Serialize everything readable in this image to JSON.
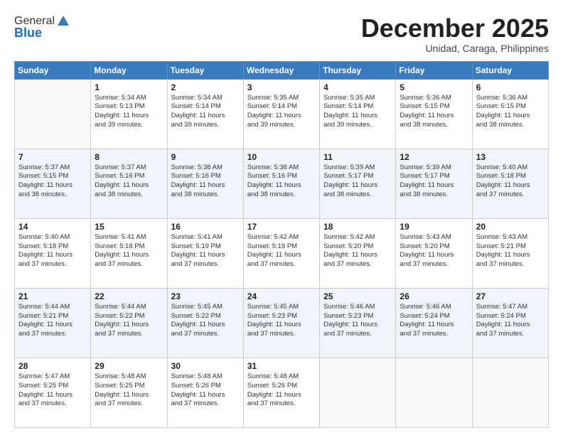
{
  "header": {
    "logo_general": "General",
    "logo_blue": "Blue",
    "month_title": "December 2025",
    "subtitle": "Unidad, Caraga, Philippines"
  },
  "weekdays": [
    "Sunday",
    "Monday",
    "Tuesday",
    "Wednesday",
    "Thursday",
    "Friday",
    "Saturday"
  ],
  "rows": [
    [
      {
        "day": "",
        "text": ""
      },
      {
        "day": "1",
        "text": "Sunrise: 5:34 AM\nSunset: 5:13 PM\nDaylight: 11 hours\nand 39 minutes."
      },
      {
        "day": "2",
        "text": "Sunrise: 5:34 AM\nSunset: 5:14 PM\nDaylight: 11 hours\nand 39 minutes."
      },
      {
        "day": "3",
        "text": "Sunrise: 5:35 AM\nSunset: 5:14 PM\nDaylight: 11 hours\nand 39 minutes."
      },
      {
        "day": "4",
        "text": "Sunrise: 5:35 AM\nSunset: 5:14 PM\nDaylight: 11 hours\nand 39 minutes."
      },
      {
        "day": "5",
        "text": "Sunrise: 5:36 AM\nSunset: 5:15 PM\nDaylight: 11 hours\nand 38 minutes."
      },
      {
        "day": "6",
        "text": "Sunrise: 5:36 AM\nSunset: 5:15 PM\nDaylight: 11 hours\nand 38 minutes."
      }
    ],
    [
      {
        "day": "7",
        "text": "Sunrise: 5:37 AM\nSunset: 5:15 PM\nDaylight: 11 hours\nand 38 minutes."
      },
      {
        "day": "8",
        "text": "Sunrise: 5:37 AM\nSunset: 5:16 PM\nDaylight: 11 hours\nand 38 minutes."
      },
      {
        "day": "9",
        "text": "Sunrise: 5:38 AM\nSunset: 5:16 PM\nDaylight: 11 hours\nand 38 minutes."
      },
      {
        "day": "10",
        "text": "Sunrise: 5:38 AM\nSunset: 5:16 PM\nDaylight: 11 hours\nand 38 minutes."
      },
      {
        "day": "11",
        "text": "Sunrise: 5:39 AM\nSunset: 5:17 PM\nDaylight: 11 hours\nand 38 minutes."
      },
      {
        "day": "12",
        "text": "Sunrise: 5:39 AM\nSunset: 5:17 PM\nDaylight: 11 hours\nand 38 minutes."
      },
      {
        "day": "13",
        "text": "Sunrise: 5:40 AM\nSunset: 5:18 PM\nDaylight: 11 hours\nand 37 minutes."
      }
    ],
    [
      {
        "day": "14",
        "text": "Sunrise: 5:40 AM\nSunset: 5:18 PM\nDaylight: 11 hours\nand 37 minutes."
      },
      {
        "day": "15",
        "text": "Sunrise: 5:41 AM\nSunset: 5:18 PM\nDaylight: 11 hours\nand 37 minutes."
      },
      {
        "day": "16",
        "text": "Sunrise: 5:41 AM\nSunset: 5:19 PM\nDaylight: 11 hours\nand 37 minutes."
      },
      {
        "day": "17",
        "text": "Sunrise: 5:42 AM\nSunset: 5:19 PM\nDaylight: 11 hours\nand 37 minutes."
      },
      {
        "day": "18",
        "text": "Sunrise: 5:42 AM\nSunset: 5:20 PM\nDaylight: 11 hours\nand 37 minutes."
      },
      {
        "day": "19",
        "text": "Sunrise: 5:43 AM\nSunset: 5:20 PM\nDaylight: 11 hours\nand 37 minutes."
      },
      {
        "day": "20",
        "text": "Sunrise: 5:43 AM\nSunset: 5:21 PM\nDaylight: 11 hours\nand 37 minutes."
      }
    ],
    [
      {
        "day": "21",
        "text": "Sunrise: 5:44 AM\nSunset: 5:21 PM\nDaylight: 11 hours\nand 37 minutes."
      },
      {
        "day": "22",
        "text": "Sunrise: 5:44 AM\nSunset: 5:22 PM\nDaylight: 11 hours\nand 37 minutes."
      },
      {
        "day": "23",
        "text": "Sunrise: 5:45 AM\nSunset: 5:22 PM\nDaylight: 11 hours\nand 37 minutes."
      },
      {
        "day": "24",
        "text": "Sunrise: 5:45 AM\nSunset: 5:23 PM\nDaylight: 11 hours\nand 37 minutes."
      },
      {
        "day": "25",
        "text": "Sunrise: 5:46 AM\nSunset: 5:23 PM\nDaylight: 11 hours\nand 37 minutes."
      },
      {
        "day": "26",
        "text": "Sunrise: 5:46 AM\nSunset: 5:24 PM\nDaylight: 11 hours\nand 37 minutes."
      },
      {
        "day": "27",
        "text": "Sunrise: 5:47 AM\nSunset: 5:24 PM\nDaylight: 11 hours\nand 37 minutes."
      }
    ],
    [
      {
        "day": "28",
        "text": "Sunrise: 5:47 AM\nSunset: 5:25 PM\nDaylight: 11 hours\nand 37 minutes."
      },
      {
        "day": "29",
        "text": "Sunrise: 5:48 AM\nSunset: 5:25 PM\nDaylight: 11 hours\nand 37 minutes."
      },
      {
        "day": "30",
        "text": "Sunrise: 5:48 AM\nSunset: 5:26 PM\nDaylight: 11 hours\nand 37 minutes."
      },
      {
        "day": "31",
        "text": "Sunrise: 5:48 AM\nSunset: 5:26 PM\nDaylight: 11 hours\nand 37 minutes."
      },
      {
        "day": "",
        "text": ""
      },
      {
        "day": "",
        "text": ""
      },
      {
        "day": "",
        "text": ""
      }
    ]
  ]
}
